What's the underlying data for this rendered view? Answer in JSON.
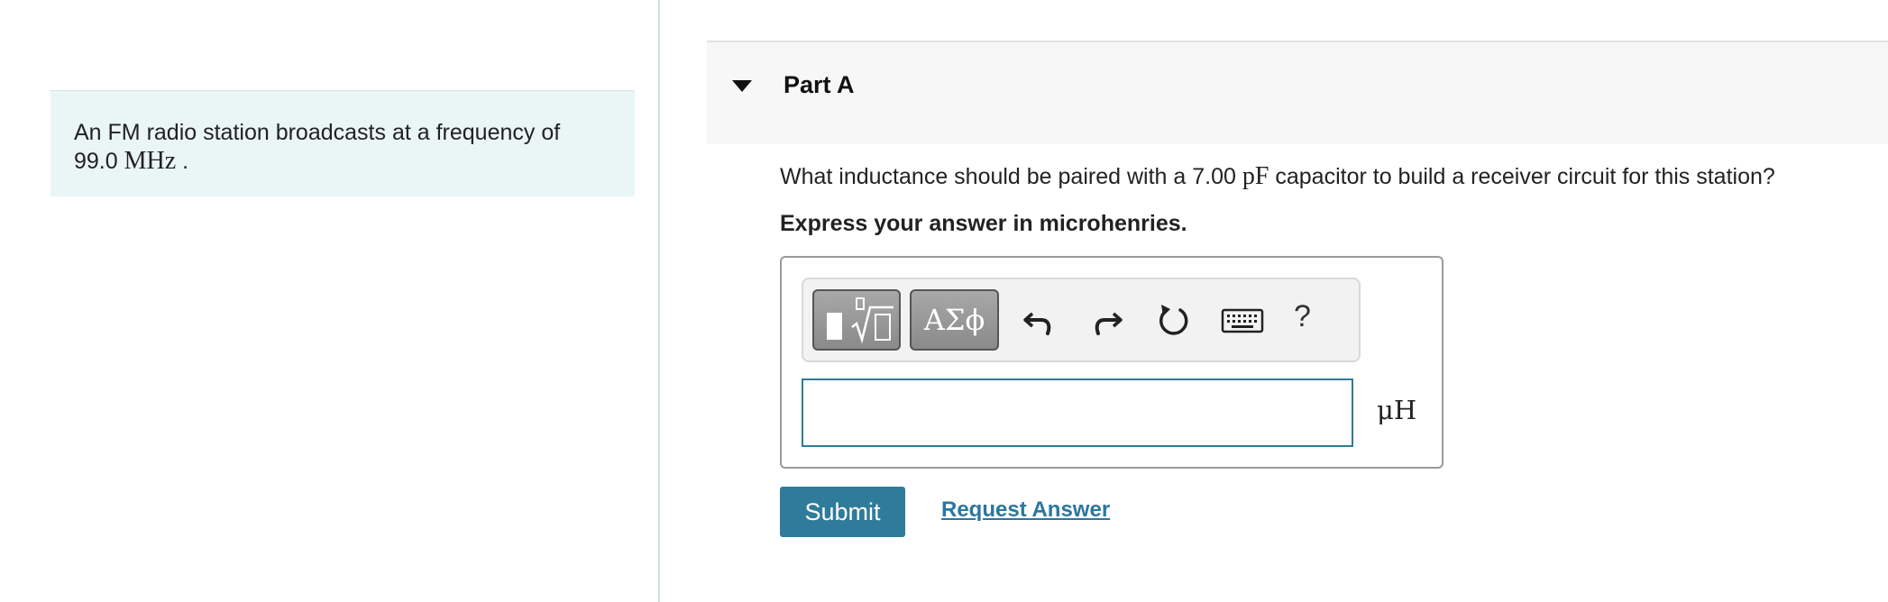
{
  "intro": {
    "text_before": "An FM radio station broadcasts at a frequency of",
    "value": "99.0",
    "unit": "MHz",
    "text_after": "."
  },
  "part": {
    "title": "Part A"
  },
  "question": {
    "before": "What inductance should be paired with a 7.00",
    "unit": "pF",
    "after": "capacitor to build a receiver circuit for this station?"
  },
  "instruction": "Express your answer in microhenries.",
  "toolbar": {
    "symbols_label": "ΑΣϕ",
    "help_label": "?",
    "icons": [
      "templates-icon",
      "symbols-icon",
      "undo-icon",
      "redo-icon",
      "reset-icon",
      "keyboard-icon",
      "help-icon"
    ]
  },
  "answer": {
    "value": "",
    "unit": "μH"
  },
  "actions": {
    "submit_label": "Submit",
    "request_label": "Request Answer"
  },
  "colors": {
    "accent": "#2f7b9a",
    "intro_bg": "#eaf5f6",
    "link": "#2a77a0"
  }
}
